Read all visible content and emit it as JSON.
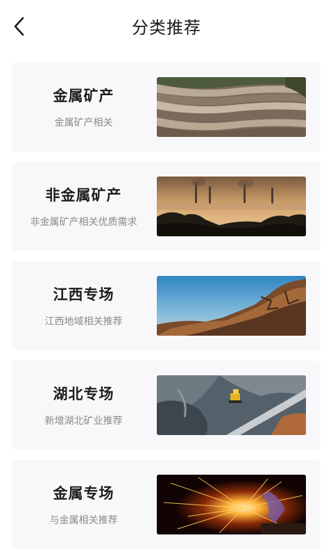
{
  "header": {
    "title": "分类推荐",
    "back_icon": "chevron-left-icon"
  },
  "cards": [
    {
      "title": "金属矿产",
      "subtitle": "金属矿产相关",
      "image": "open-pit-mine-photo"
    },
    {
      "title": "非金属矿产",
      "subtitle": "非金属矿产相关优质需求",
      "image": "industrial-smokestacks-photo"
    },
    {
      "title": "江西专场",
      "subtitle": "江西地域相关推荐",
      "image": "rocky-cliff-photo"
    },
    {
      "title": "湖北专场",
      "subtitle": "新增湖北矿业推荐",
      "image": "quarry-excavator-photo"
    },
    {
      "title": "金属专场",
      "subtitle": "与金属相关推荐",
      "image": "welding-sparks-photo"
    }
  ]
}
